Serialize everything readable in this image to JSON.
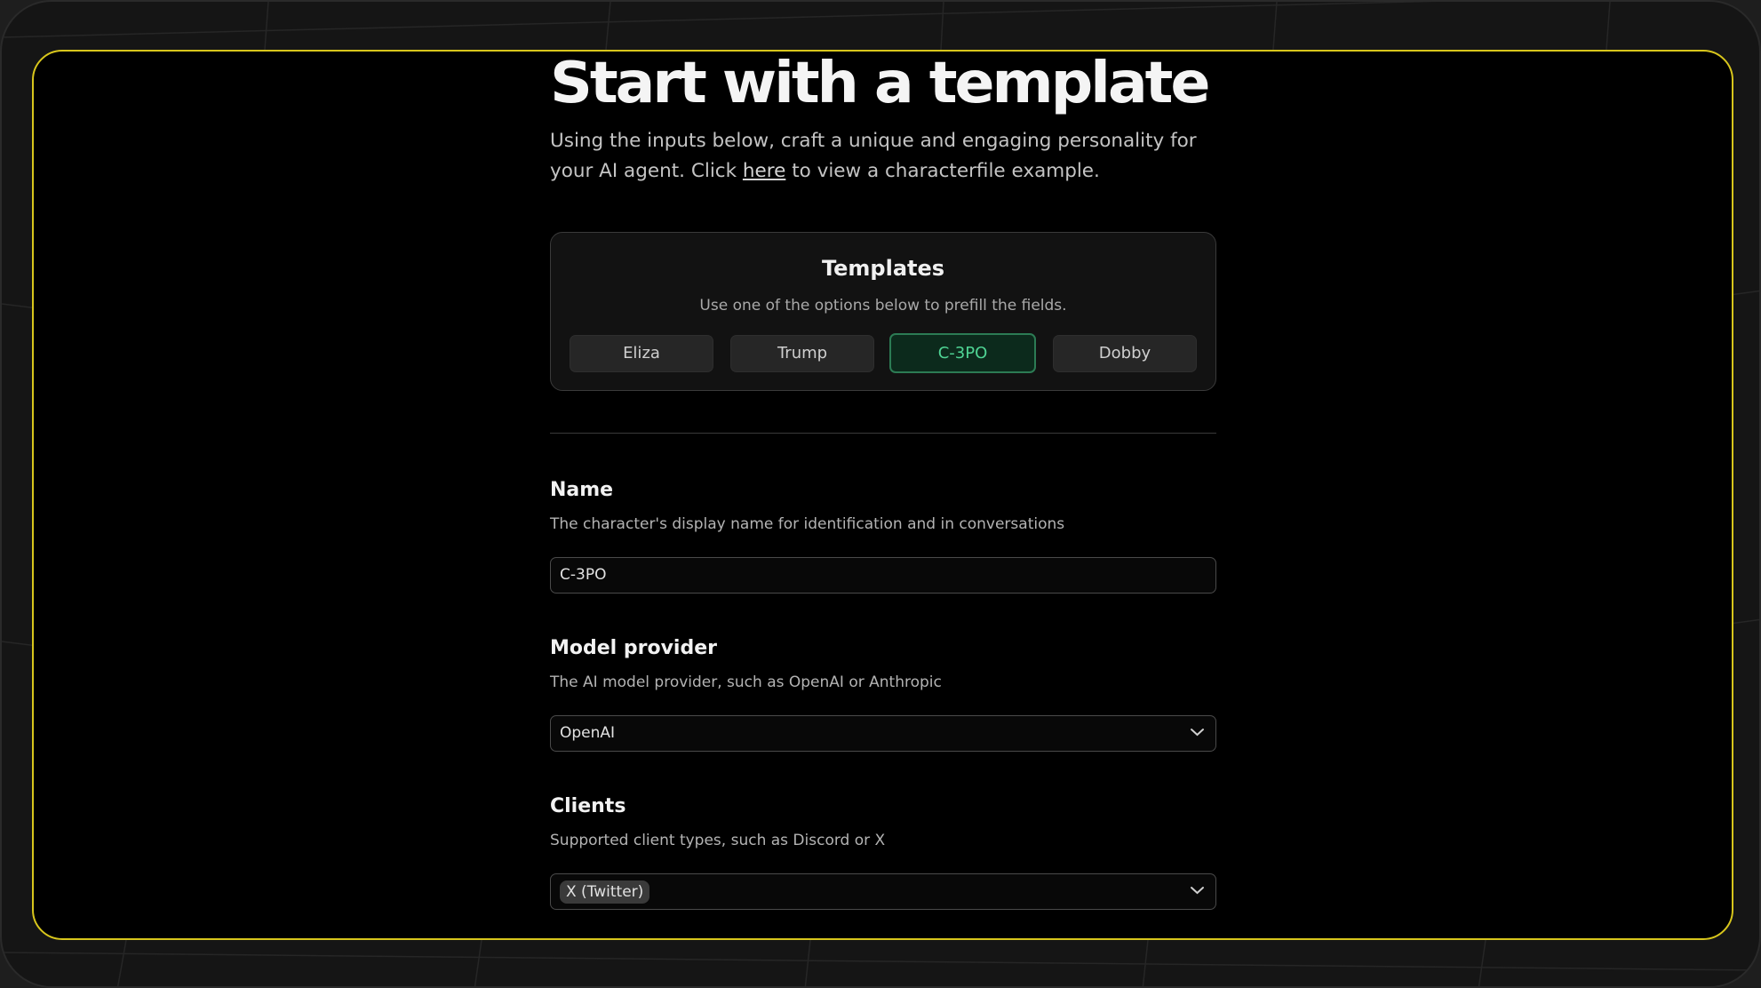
{
  "page": {
    "title": "Start with a template",
    "intro_before": "Using the inputs below, craft a unique and engaging personality for your AI agent. Click ",
    "intro_link": "here",
    "intro_after": " to view a characterfile example."
  },
  "templates": {
    "title": "Templates",
    "subtitle": "Use one of the options below to prefill the fields.",
    "options": [
      "Eliza",
      "Trump",
      "C-3PO",
      "Dobby"
    ],
    "selected": "C-3PO"
  },
  "fields": {
    "name": {
      "label": "Name",
      "description": "The character's display name for identification and in conversations",
      "value": "C-3PO"
    },
    "model_provider": {
      "label": "Model provider",
      "description": "The AI model provider, such as OpenAI or Anthropic",
      "value": "OpenAI"
    },
    "clients": {
      "label": "Clients",
      "description": "Supported client types, such as Discord or X",
      "selected_chip": "X (Twitter)"
    }
  },
  "colors": {
    "frame_border": "#d8c61c",
    "active_template_bg": "#0c2a1c",
    "active_template_border": "#2c7b54",
    "active_template_text": "#4fd494"
  },
  "icons": {
    "dropdown": "chevron-down-icon"
  }
}
